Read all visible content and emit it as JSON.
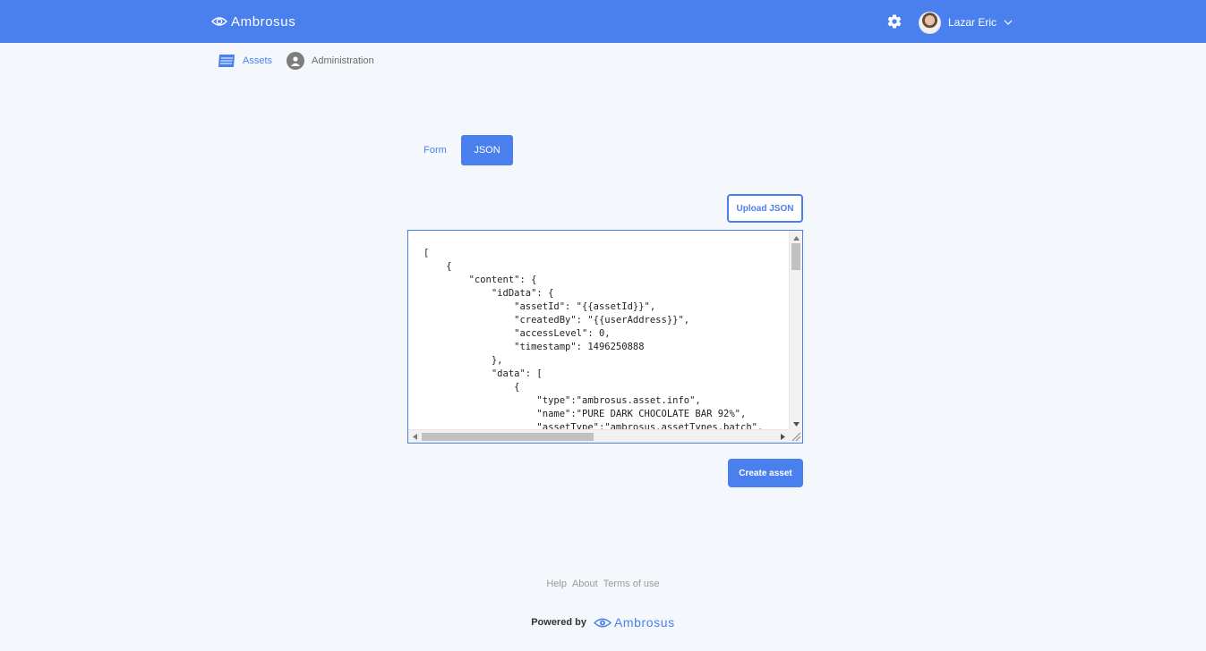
{
  "header": {
    "logo_text": "Ambrosus",
    "user_name": "Lazar Eric"
  },
  "nav": {
    "assets_label": "Assets",
    "administration_label": "Administration"
  },
  "tabs": {
    "form_label": "Form",
    "json_label": "JSON",
    "active": "JSON"
  },
  "buttons": {
    "upload_json": "Upload JSON",
    "create_asset": "Create asset"
  },
  "editor": {
    "content": "[\n    {\n        \"content\": {\n            \"idData\": {\n                \"assetId\": \"{{assetId}}\",\n                \"createdBy\": \"{{userAddress}}\",\n                \"accessLevel\": 0,\n                \"timestamp\": 1496250888\n            },\n            \"data\": [\n                {\n                    \"type\":\"ambrosus.asset.info\",\n                    \"name\":\"PURE DARK CHOCOLATE BAR 92%\",\n                    \"assetType\":\"ambrosus.assetTypes.batch\","
  },
  "footer": {
    "links": [
      "Help",
      "About",
      "Terms of use"
    ],
    "powered_by": "Powered by",
    "powered_logo_text": "Ambrosus"
  },
  "colors": {
    "primary": "#4a80ed",
    "background": "#f4f7fc"
  }
}
